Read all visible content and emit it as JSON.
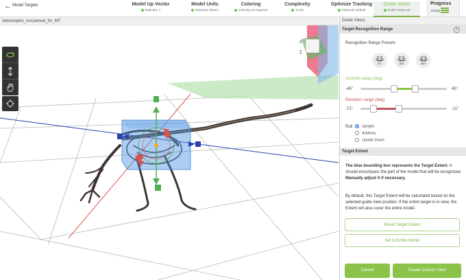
{
  "app": {
    "back_label": "←",
    "title": "Model Targets"
  },
  "steps": [
    {
      "title": "Model Up Vector",
      "status": "Selected: Y"
    },
    {
      "title": "Model Units",
      "status": "Selected: Meters"
    },
    {
      "title": "Coloring",
      "status": "Coloring not required"
    },
    {
      "title": "Complexity",
      "status": "Good"
    },
    {
      "title": "Optimize Tracking",
      "status": "Selected: Default"
    },
    {
      "title": "Guide Views",
      "status": "Guide Views set"
    }
  ],
  "progress": {
    "title": "Progress",
    "status": "Ready"
  },
  "viewport": {
    "model_name": "Velociraptor_rescanned_for_MT",
    "tool_icons": [
      "orbit-icon",
      "pan-vertical-icon",
      "hand-icon"
    ],
    "focus_icon": "crosshair-icon",
    "axis_labels": {
      "x": "X",
      "z": "Z"
    }
  },
  "panel": {
    "header": "Guide Views",
    "recognition_section": "Target Recognition Range",
    "info_glyph": "i",
    "presets_label": "Recognition Range Presets",
    "presets": [
      "90°",
      "180°",
      "360°"
    ],
    "azimuth": {
      "label": "Azimuth range (deg)",
      "min_label": "-45°",
      "max_label": "45°",
      "low_frac": 0.38,
      "high_frac": 0.65,
      "color": "#8bc34a"
    },
    "elevation": {
      "label": "Elevation range (deg)",
      "min_label": "-71°",
      "max_label": "-11°",
      "low_frac": 0.12,
      "high_frac": 0.44,
      "color": "#c0505a"
    },
    "roll_label": "Roll",
    "roll_options": [
      "Upright",
      "Arbitrary",
      "Upside Down"
    ],
    "roll_selected": "Upright",
    "extent_section": "Target Extent",
    "extent_p1_bold": "The blue bounding box represents the Target Extent.",
    "extent_p1_mid": " It should encompass the part of the model that will be recognized. ",
    "extent_p1_bold2": "Manually adjust it if necessary.",
    "extent_p2": "By default, this Target Extent will be calculated based on the selected guide view position. If the entire target is in view, the Extent will also cover the entire model.",
    "reset_button": "Reset Target Extent",
    "entire_button": "Set to Entire Model",
    "cancel_button": "Cancel",
    "create_button": "Create Custom View"
  },
  "colors": {
    "accent": "#8bc34a",
    "gizmo_green": "#4caf50",
    "gizmo_red": "#d9534f",
    "gizmo_blue": "#2b3fae",
    "box_blue": "#4a90e2"
  }
}
